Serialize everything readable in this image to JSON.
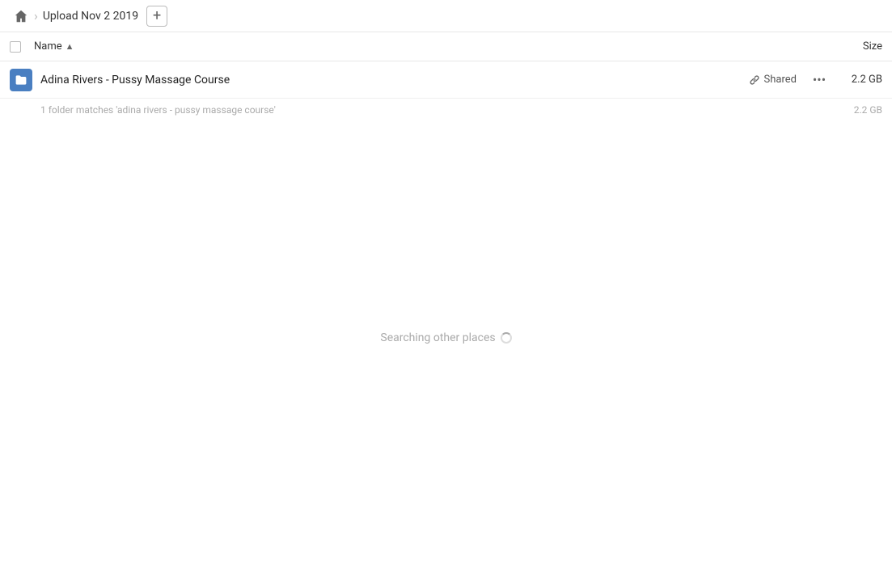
{
  "breadcrumb": {
    "home_icon": "home-icon",
    "title": "Upload Nov 2 2019",
    "add_button_label": "+"
  },
  "table": {
    "name_header": "Name",
    "size_header": "Size",
    "sort_direction": "▲"
  },
  "file_row": {
    "name": "Adina Rivers - Pussy Massage Course",
    "shared_label": "Shared",
    "size": "2.2 GB",
    "more_icon": "•••"
  },
  "match_info": {
    "text": "1 folder matches 'adina rivers - pussy massage course'",
    "size": "2.2 GB"
  },
  "searching": {
    "text": "Searching other places"
  }
}
